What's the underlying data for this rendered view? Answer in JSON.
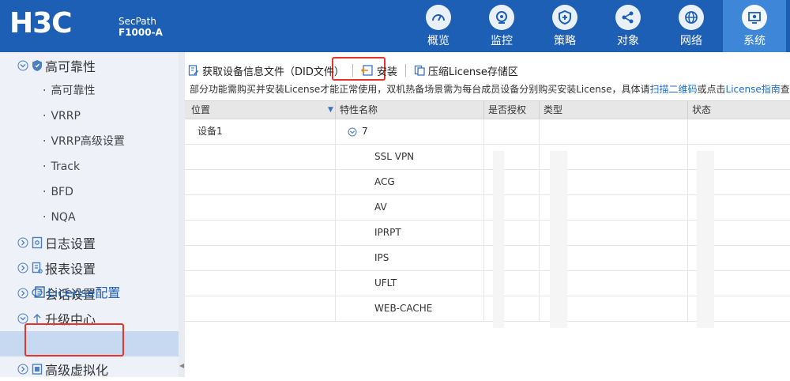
{
  "header": {
    "logo": "H3C",
    "product_line": "SecPath",
    "model": "F1000-A",
    "nav": [
      {
        "label": "概览",
        "icon": "gauge-icon"
      },
      {
        "label": "监控",
        "icon": "camera-icon"
      },
      {
        "label": "策略",
        "icon": "shield-plus-icon"
      },
      {
        "label": "对象",
        "icon": "share-nodes-icon"
      },
      {
        "label": "网络",
        "icon": "globe-icon"
      },
      {
        "label": "系统",
        "icon": "monitor-gear-icon",
        "active": true
      }
    ]
  },
  "sidebar": {
    "groups": [
      {
        "label": "高可靠性",
        "icon": "shield-icon",
        "expanded": true
      },
      {
        "label": "日志设置",
        "icon": "log-icon"
      },
      {
        "label": "报表设置",
        "icon": "report-icon"
      },
      {
        "label": "会话设置",
        "icon": "session-icon"
      },
      {
        "label": "升级中心",
        "icon": "upload-icon"
      },
      {
        "label": "高级虚拟化",
        "icon": "virtualization-icon"
      }
    ],
    "subitems": [
      "高可靠性",
      "VRRP",
      "VRRP高级设置",
      "Track",
      "BFD",
      "NQA"
    ],
    "active_item": "License配置",
    "bullet": "·"
  },
  "toolbar": {
    "get_info_label": "获取设备信息文件（DID文件）",
    "install_label": "安装",
    "compress_label": "压缩License存储区"
  },
  "notice": {
    "text_before": "部分功能需购买并安装License才能正常使用，双机热备场景需为每台成员设备分别购买安装License，具体请",
    "link1": "扫描二维码",
    "text_middle": "或点击",
    "link2": "License指南",
    "text_after": "查阅"
  },
  "table": {
    "columns": [
      "位置",
      "特性名称",
      "是否授权",
      "类型",
      "状态"
    ],
    "device": "设备1",
    "group_count": "7",
    "features": [
      "SSL VPN",
      "ACG",
      "AV",
      "IPRPT",
      "IPS",
      "UFLT",
      "WEB-CACHE"
    ]
  },
  "colors": {
    "header_bg": "#1d5fb5",
    "active_nav": "#3d86d8",
    "highlight_box": "#e8332a",
    "link": "#1d6fce"
  }
}
